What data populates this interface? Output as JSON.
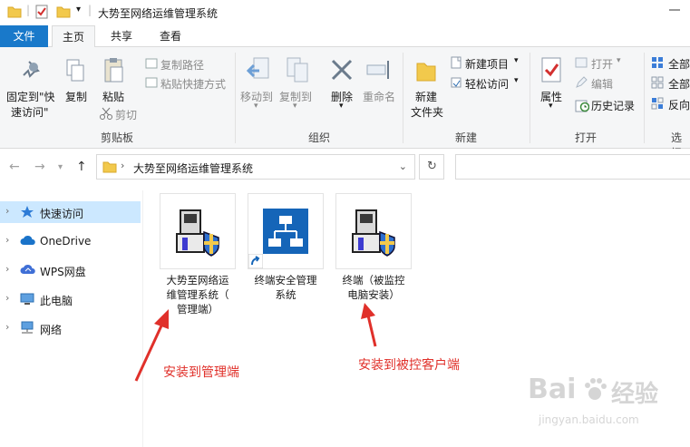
{
  "window": {
    "title": "大势至网络运维管理系统"
  },
  "tabs": [
    {
      "label": "文件"
    },
    {
      "label": "主页"
    },
    {
      "label": "共享"
    },
    {
      "label": "查看"
    }
  ],
  "ribbon": {
    "clipboard": {
      "pin_line1": "固定到\"快",
      "pin_line2": "速访问\"",
      "copy": "复制",
      "paste": "粘贴",
      "copy_path": "复制路径",
      "paste_shortcut": "粘贴快捷方式",
      "cut": "剪切",
      "group": "剪贴板"
    },
    "organize": {
      "move_to": "移动到",
      "copy_to": "复制到",
      "delete": "删除",
      "rename": "重命名",
      "group": "组织"
    },
    "new": {
      "new_folder_line1": "新建",
      "new_folder_line2": "文件夹",
      "new_item": "新建项目",
      "easy_access": "轻松访问",
      "group": "新建"
    },
    "open": {
      "properties": "属性",
      "open": "打开",
      "edit": "编辑",
      "history": "历史记录",
      "group": "打开"
    },
    "select": {
      "select_all": "全部",
      "select_none": "全部",
      "invert": "反向",
      "group": "选择"
    }
  },
  "address": {
    "path": "大势至网络运维管理系统"
  },
  "nav": [
    {
      "label": "快速访问",
      "icon": "star-icon"
    },
    {
      "label": "OneDrive",
      "icon": "cloud-icon"
    },
    {
      "label": "WPS网盘",
      "icon": "cloud-icon"
    },
    {
      "label": "此电脑",
      "icon": "computer-icon"
    },
    {
      "label": "网络",
      "icon": "network-icon"
    }
  ],
  "files": [
    {
      "line1": "大势至网络运",
      "line2": "维管理系统（",
      "line3": "管理端）",
      "icon": "installer-icon"
    },
    {
      "line1": "终端安全管理",
      "line2": "系统",
      "line3": "",
      "icon": "shortcut-network-icon"
    },
    {
      "line1": "终端（被监控",
      "line2": "电脑安装）",
      "line3": "",
      "icon": "installer-icon"
    }
  ],
  "annotations": {
    "admin": "安装到管理端",
    "client": "安装到被控客户端"
  },
  "watermark": {
    "text1": "Bai",
    "text2": "经验",
    "text3": "jingyan.baidu.com"
  },
  "colors": {
    "accent": "#1979ca",
    "annotation": "#e0302a",
    "selection": "#cce8ff"
  }
}
